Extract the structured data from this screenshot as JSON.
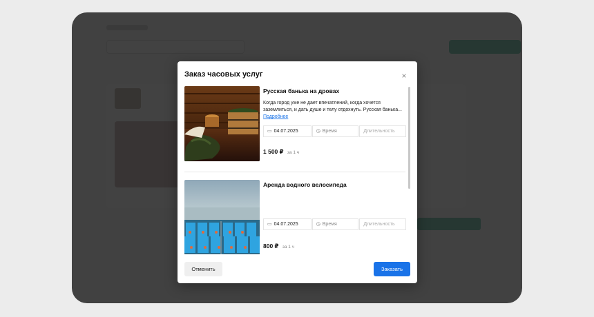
{
  "modal": {
    "title": "Заказ часовых услуг",
    "close_label": "×"
  },
  "services": [
    {
      "name": "Русская банька на дровах",
      "description_lines": [
        "Когда город уже не дает впечатлений, когда хочется",
        "заземлиться, и дать душе и телу отдохнуть. Русская банька..."
      ],
      "more_link": "Подробнее",
      "date": "04.07.2025",
      "time_placeholder": "Время",
      "duration_placeholder": "Длительность",
      "price": "1 500 ₽",
      "price_unit": "за 1 ч",
      "image_icon": "sauna-photo"
    },
    {
      "name": "Аренда водного велосипеда",
      "date": "04.07.2025",
      "time_placeholder": "Время",
      "duration_placeholder": "Длительность",
      "price": "800 ₽",
      "price_unit": "за 1 ч",
      "image_icon": "pedal-boats-photo"
    }
  ],
  "icons": {
    "calendar": "calendar-icon",
    "clock": "clock-icon"
  },
  "footer": {
    "cancel_label": "Отменить",
    "order_label": "Заказать"
  },
  "colors": {
    "primary": "#1a73e8",
    "overlay": "#2a2a2a",
    "background_accent": "#1fa37d"
  }
}
